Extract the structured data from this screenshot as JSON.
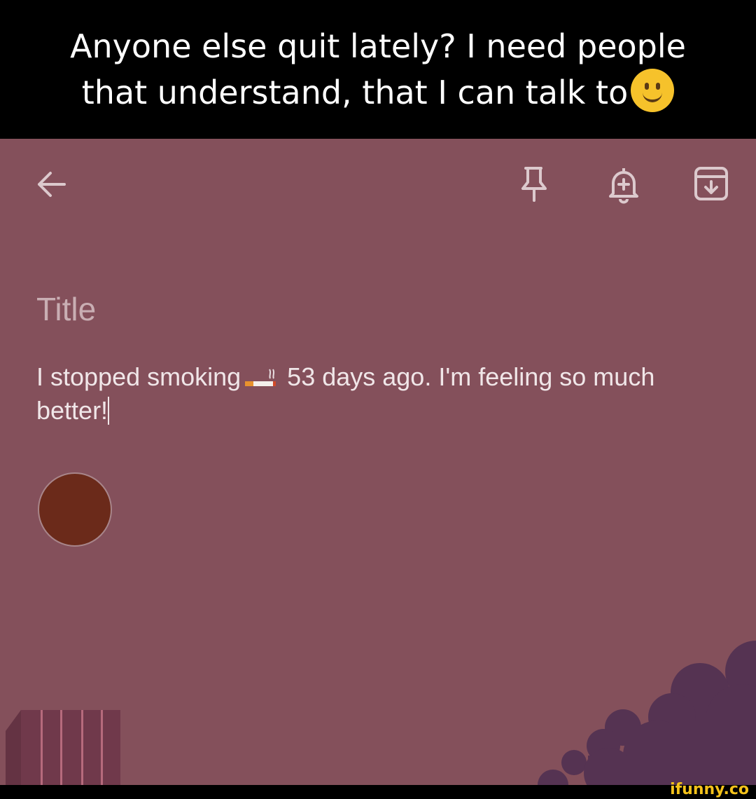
{
  "caption": {
    "line1": "Anyone else quit lately? I need people",
    "line2": "that understand, that I can talk to",
    "emoji": "slightly-smiling-face"
  },
  "toolbar": {
    "back_icon": "arrow-back-icon",
    "pin_icon": "pin-icon",
    "reminder_icon": "bell-plus-icon",
    "archive_icon": "archive-icon"
  },
  "note": {
    "title_placeholder": "Title",
    "body_before": "I stopped smoking",
    "body_emoji": "cigarette",
    "body_after": "53 days ago. I'm feeling so much better!",
    "background_color": "#84505b",
    "selected_color": "#6b2a1a"
  },
  "watermark": "ifunny.co"
}
